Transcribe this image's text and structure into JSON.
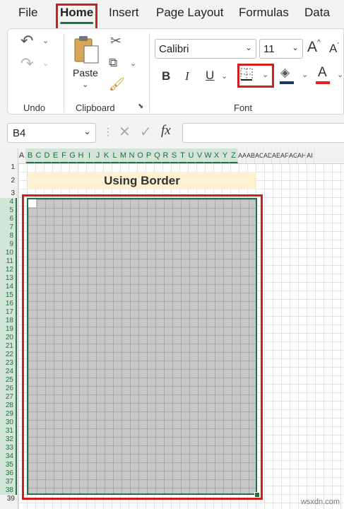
{
  "menu": {
    "tabs": [
      "File",
      "Home",
      "Insert",
      "Page Layout",
      "Formulas",
      "Data"
    ],
    "active_tab": "Home"
  },
  "ribbon": {
    "undo_group": {
      "label": "Undo"
    },
    "clipboard_group": {
      "label": "Clipboard",
      "paste_label": "Paste"
    },
    "font_group": {
      "label": "Font",
      "font_name": "Calibri",
      "font_size": "11",
      "bold": "B",
      "italic": "I",
      "underline": "U",
      "font_color_glyph": "A",
      "grow_glyph": "A",
      "shrink_glyph": "A"
    }
  },
  "formula_bar": {
    "name_box": "B4",
    "fx_label": "fx"
  },
  "sheet": {
    "columns": [
      "A",
      "B",
      "C",
      "D",
      "E",
      "F",
      "G",
      "H",
      "I",
      "J",
      "K",
      "L",
      "M",
      "N",
      "O",
      "P",
      "Q",
      "R",
      "S",
      "T",
      "U",
      "V",
      "W",
      "X",
      "Y",
      "Z",
      "AA",
      "AB",
      "AC",
      "AD",
      "AE",
      "AF",
      "AG",
      "AH",
      "AI"
    ],
    "rows": [
      "1",
      "2",
      "3",
      "4",
      "5",
      "6",
      "7",
      "8",
      "9",
      "10",
      "11",
      "12",
      "13",
      "14",
      "15",
      "16",
      "17",
      "18",
      "19",
      "20",
      "21",
      "22",
      "23",
      "24",
      "25",
      "26",
      "27",
      "28",
      "29",
      "30",
      "31",
      "32",
      "33",
      "34",
      "35",
      "36",
      "37",
      "38",
      "39"
    ],
    "title_cell": "Using Border"
  },
  "colors": {
    "accent_green": "#217346",
    "highlight_red": "#d11f1f",
    "title_fill": "#fdf1d1",
    "selection_fill": "#c8c8c8"
  },
  "watermark": "wsxdn.com"
}
